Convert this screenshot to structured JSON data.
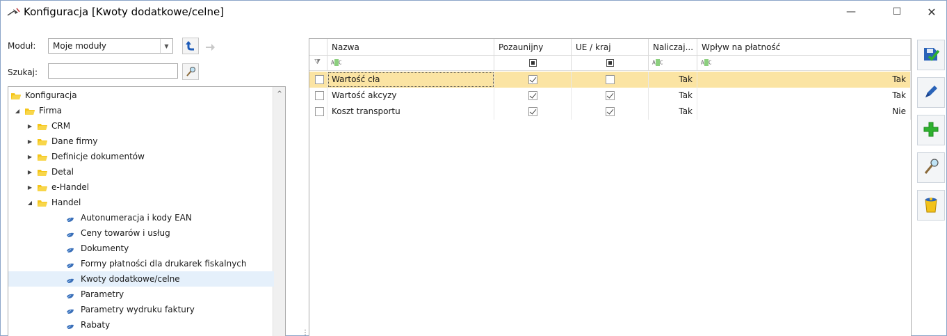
{
  "window": {
    "title": "Konfiguracja [Kwoty dodatkowe/celne]",
    "minimize": "—",
    "maximize": "☐",
    "close": "✕"
  },
  "left": {
    "modul_label": "Moduł:",
    "modul_value": "Moje moduły",
    "szukaj_label": "Szukaj:",
    "szukaj_value": ""
  },
  "tree": {
    "items": [
      {
        "label": "Konfiguracja",
        "level": 0,
        "type": "folder",
        "expander": ""
      },
      {
        "label": "Firma",
        "level": 1,
        "type": "folder",
        "expander": "◢"
      },
      {
        "label": "CRM",
        "level": 2,
        "type": "folder",
        "expander": "▶"
      },
      {
        "label": "Dane firmy",
        "level": 2,
        "type": "folder",
        "expander": "▶"
      },
      {
        "label": "Definicje dokumentów",
        "level": 2,
        "type": "folder",
        "expander": "▶"
      },
      {
        "label": "Detal",
        "level": 2,
        "type": "folder",
        "expander": "▶"
      },
      {
        "label": "e-Handel",
        "level": 2,
        "type": "folder",
        "expander": "▶"
      },
      {
        "label": "Handel",
        "level": 2,
        "type": "folder",
        "expander": "◢"
      },
      {
        "label": "Autonumeracja i kody EAN",
        "level": 3,
        "type": "leaf",
        "expander": ""
      },
      {
        "label": "Ceny towarów i usług",
        "level": 3,
        "type": "leaf",
        "expander": ""
      },
      {
        "label": "Dokumenty",
        "level": 3,
        "type": "leaf",
        "expander": ""
      },
      {
        "label": "Formy płatności dla drukarek fiskalnych",
        "level": 3,
        "type": "leaf",
        "expander": ""
      },
      {
        "label": "Kwoty dodatkowe/celne",
        "level": 3,
        "type": "leaf",
        "expander": "",
        "selected": true
      },
      {
        "label": "Parametry",
        "level": 3,
        "type": "leaf",
        "expander": ""
      },
      {
        "label": "Parametry wydruku faktury",
        "level": 3,
        "type": "leaf",
        "expander": ""
      },
      {
        "label": "Rabaty",
        "level": 3,
        "type": "leaf",
        "expander": ""
      }
    ],
    "scroll_up": "^"
  },
  "splitter": {
    "dots": "⋮"
  },
  "grid": {
    "columns": [
      {
        "label": "",
        "filter": "funnel"
      },
      {
        "label": "Nazwa",
        "filter": "abc"
      },
      {
        "label": "Pozaunijny",
        "filter": "square"
      },
      {
        "label": "UE / kraj",
        "filter": "square"
      },
      {
        "label": "Naliczaj...",
        "filter": "abc"
      },
      {
        "label": "Wpływ na płatność",
        "filter": "abc"
      }
    ],
    "filter_abc": "A B C",
    "funnel": "⧩",
    "rows": [
      {
        "nazwa": "Wartość cła",
        "pozaunijny": true,
        "ue_kraj": false,
        "naliczaj": "Tak",
        "wplyw": "Tak",
        "selected": true
      },
      {
        "nazwa": "Wartość akcyzy",
        "pozaunijny": true,
        "ue_kraj": true,
        "naliczaj": "Tak",
        "wplyw": "Tak"
      },
      {
        "nazwa": "Koszt transportu",
        "pozaunijny": true,
        "ue_kraj": true,
        "naliczaj": "Tak",
        "wplyw": "Nie"
      }
    ]
  },
  "toolbar": {
    "buttons": [
      {
        "icon": "save-icon"
      },
      {
        "icon": "edit-icon"
      },
      {
        "icon": "add-icon"
      },
      {
        "icon": "preview-icon"
      },
      {
        "icon": "delete-icon"
      }
    ]
  },
  "colors": {
    "selected_row": "#fbe4a3",
    "tree_selected": "#e5f0fb",
    "folder": "#f5c518",
    "leaf": "#3a6fb8",
    "add": "#2fb12f"
  }
}
